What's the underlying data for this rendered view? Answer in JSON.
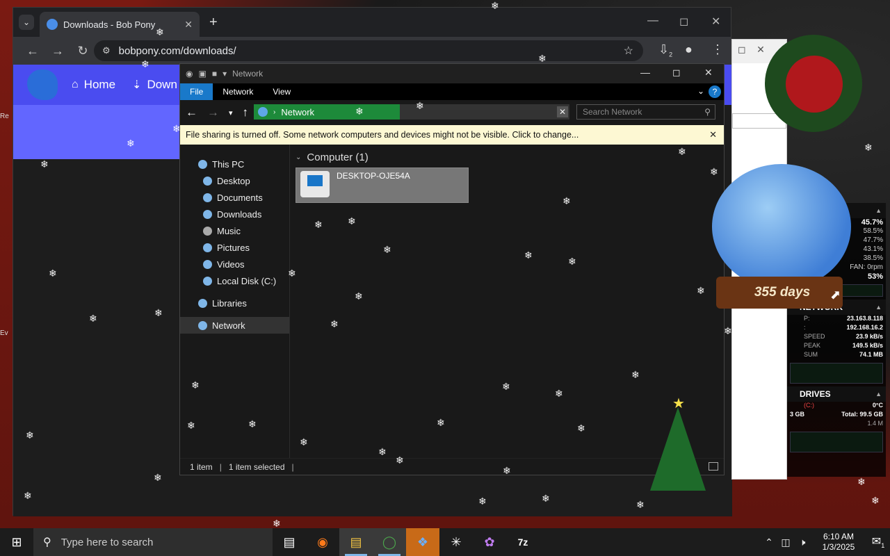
{
  "chrome": {
    "tab_title": "Downloads - Bob Pony",
    "url": "bobpony.com/downloads/",
    "download_badge": "2"
  },
  "site": {
    "nav_home": "Home",
    "nav_downloads": "Down"
  },
  "explorer": {
    "title": "Network",
    "ribbon_tabs": [
      "File",
      "Network",
      "View"
    ],
    "address_crumb": "Network",
    "search_placeholder": "Search Network",
    "infobar_text": "File sharing is turned off. Some network computers and devices might not be visible. Click to change...",
    "nav_items": [
      {
        "label": "This PC",
        "level": 1
      },
      {
        "label": "Desktop",
        "level": 2
      },
      {
        "label": "Documents",
        "level": 2
      },
      {
        "label": "Downloads",
        "level": 2
      },
      {
        "label": "Music",
        "level": 2
      },
      {
        "label": "Pictures",
        "level": 2
      },
      {
        "label": "Videos",
        "level": 2
      },
      {
        "label": "Local Disk (C:)",
        "level": 2
      },
      {
        "label": "Libraries",
        "level": 1
      },
      {
        "label": "Network",
        "level": 1,
        "selected": true
      }
    ],
    "group_header": "Computer (1)",
    "computer_name": "DESKTOP-OJE54A",
    "status_items": "1 item",
    "status_selected": "1 item selected"
  },
  "gadgets": {
    "globe_days": "355 days",
    "sysmon": {
      "cpu_lines": [
        "45.7%",
        "58.5%",
        "47.7%",
        "43.1%",
        "38.5%",
        "FAN: 0rpm",
        "53%"
      ],
      "network_header": "NETWORK",
      "ip_external": "23.163.8.118",
      "ip_internal": "192.168.16.2",
      "speed_label": "SPEED",
      "speed_value": "23.9 kB/s",
      "peak_label": "PEAK",
      "peak_value": "149.5 kB/s",
      "sum_label": "SUM",
      "sum_value": "74.1 MB",
      "drives_header": "DRIVES",
      "drive_c": "(C:)",
      "drive_temp": "0°C",
      "drive_used": "3 GB",
      "drive_total": "Total: 99.5 GB",
      "drive_rate": "1.4 M"
    }
  },
  "taskbar": {
    "search_placeholder": "Type here to search",
    "time": "6:10 AM",
    "date": "1/3/2025",
    "notif_count": "1"
  },
  "colors": {
    "site_nav": "#4a4cf0",
    "explorer_file_tab": "#1979ca",
    "address_crumb": "#1d8a3a",
    "infobar": "#fdf8d3"
  }
}
